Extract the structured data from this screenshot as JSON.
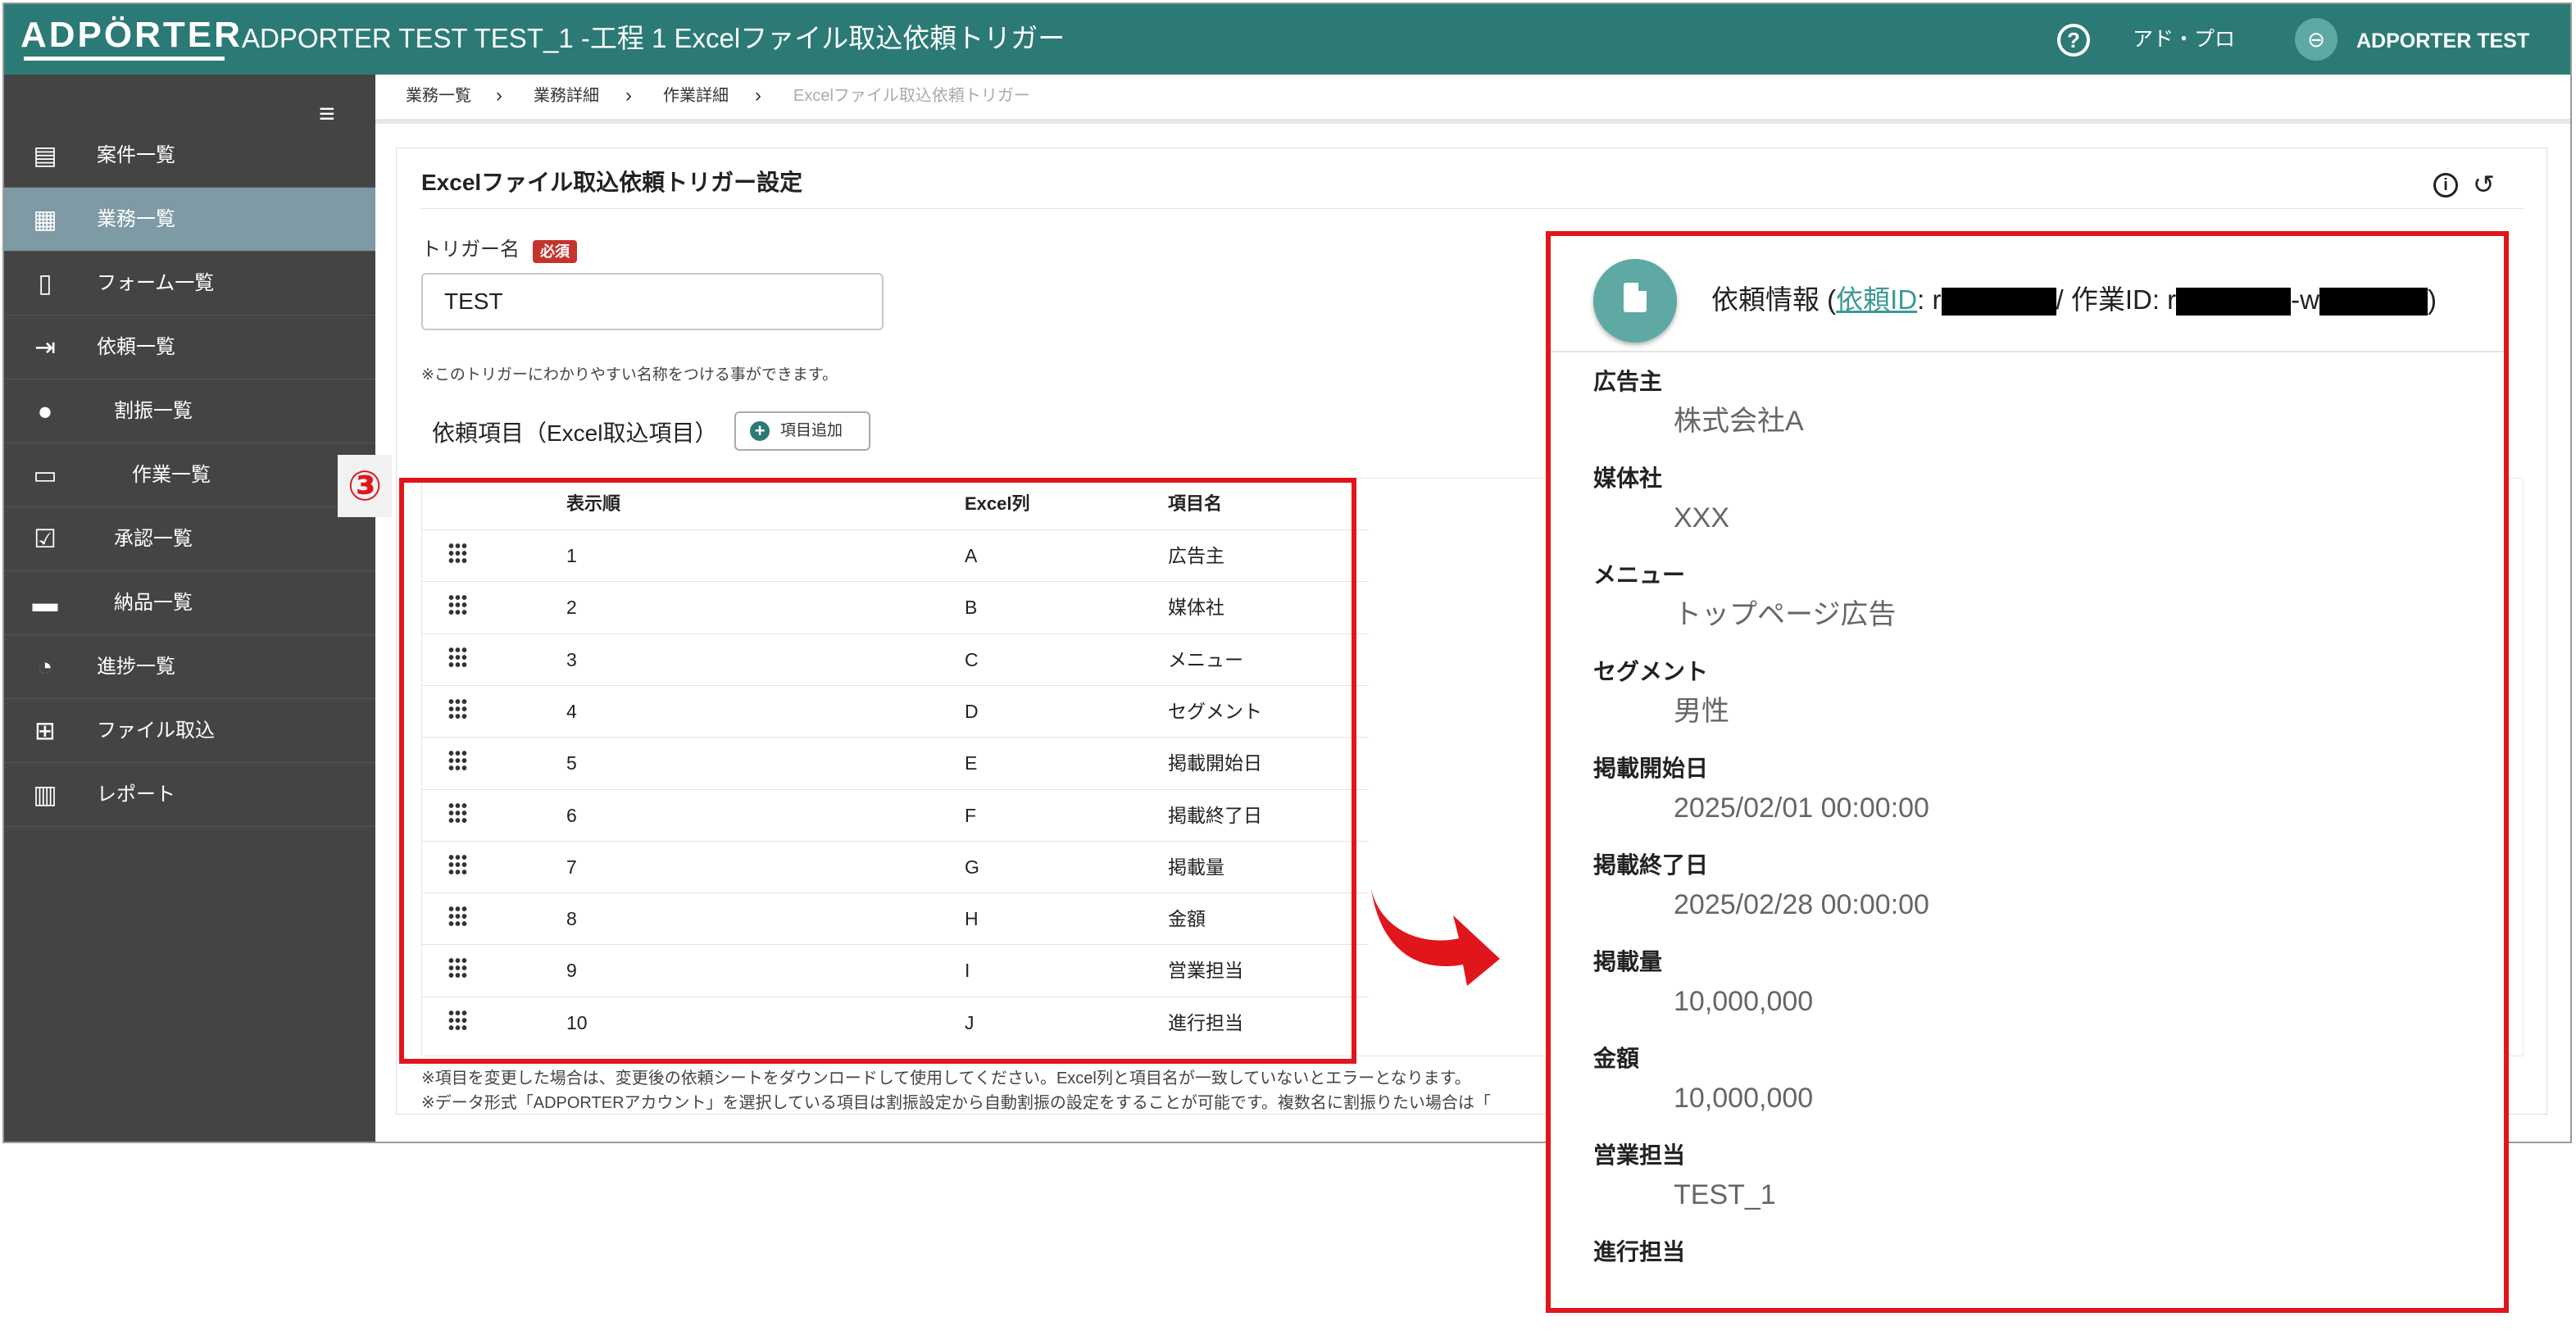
{
  "header": {
    "logo": "ADPÖRTER",
    "title": "ADPORTER TEST TEST_1 -工程 1 Excelファイル取込依頼トリガー",
    "help_icon": "help-circle-icon",
    "user_link": "アド・プロ",
    "avatar_icon": "robot-icon",
    "username": "ADPORTER TEST"
  },
  "sidebar": {
    "menu_icon": "hamburger-icon",
    "items": [
      {
        "label": "案件一覧",
        "icon": "document-icon",
        "glyph": "▤"
      },
      {
        "label": "業務一覧",
        "icon": "building-icon",
        "glyph": "▦"
      },
      {
        "label": "フォーム一覧",
        "icon": "form-icon",
        "glyph": "▯"
      },
      {
        "label": "依頼一覧",
        "icon": "inbox-icon",
        "glyph": "⇥"
      },
      {
        "label": "割振一覧",
        "icon": "people-icon",
        "glyph": "●"
      },
      {
        "label": "作業一覧",
        "icon": "monitor-icon",
        "glyph": "▭"
      },
      {
        "label": "承認一覧",
        "icon": "approval-icon",
        "glyph": "☑"
      },
      {
        "label": "納品一覧",
        "icon": "truck-icon",
        "glyph": "▬"
      },
      {
        "label": "進捗一覧",
        "icon": "clock-icon",
        "glyph": "◔"
      },
      {
        "label": "ファイル取込",
        "icon": "table-add-icon",
        "glyph": "⊞"
      },
      {
        "label": "レポート",
        "icon": "bar-chart-icon",
        "glyph": "▥"
      }
    ]
  },
  "breadcrumb": [
    "業務一覧",
    "業務詳細",
    "作業詳細",
    "Excelファイル取込依頼トリガー"
  ],
  "card": {
    "title": "Excelファイル取込依頼トリガー設定",
    "info_icon": "info-icon",
    "history_icon": "history-icon",
    "trigger_label": "トリガー名",
    "required_badge": "必須",
    "trigger_value": "TEST",
    "trigger_note": "※このトリガーにわかりやすい名称をつける事ができます。",
    "items_title": "依頼項目（Excel取込項目）",
    "add_button": "項目追加",
    "table": {
      "headers": [
        "表示順",
        "Excel列",
        "項目名"
      ],
      "rows": [
        [
          "1",
          "A",
          "広告主"
        ],
        [
          "2",
          "B",
          "媒体社"
        ],
        [
          "3",
          "C",
          "メニュー"
        ],
        [
          "4",
          "D",
          "セグメント"
        ],
        [
          "5",
          "E",
          "掲載開始日"
        ],
        [
          "6",
          "F",
          "掲載終了日"
        ],
        [
          "7",
          "G",
          "掲載量"
        ],
        [
          "8",
          "H",
          "金額"
        ],
        [
          "9",
          "I",
          "営業担当"
        ],
        [
          "10",
          "J",
          "進行担当"
        ]
      ]
    },
    "note1": "※項目を変更した場合は、変更後の依頼シートをダウンロードして使用してください。Excel列と項目名が一致していないとエラーとなります。",
    "note2": "※データ形式「ADPORTERアカウント」を選択している項目は割振設定から自動割振の設定をすることが可能です。複数名に割振りたい場合は「"
  },
  "annotation": {
    "step": "③"
  },
  "panel": {
    "title_prefix": "依頼情報 (",
    "title_link": "依頼ID",
    "title_colon": ": r",
    "title_mid": "/ 作業ID: r",
    "title_w": "-w",
    "title_suffix": ")",
    "fields": [
      {
        "label": "広告主",
        "value": "株式会社A"
      },
      {
        "label": "媒体社",
        "value": "XXX"
      },
      {
        "label": "メニュー",
        "value": "トップページ広告"
      },
      {
        "label": "セグメント",
        "value": "男性"
      },
      {
        "label": "掲載開始日",
        "value": "2025/02/01 00:00:00"
      },
      {
        "label": "掲載終了日",
        "value": "2025/02/28 00:00:00"
      },
      {
        "label": "掲載量",
        "value": "10,000,000"
      },
      {
        "label": "金額",
        "value": "10,000,000"
      },
      {
        "label": "営業担当",
        "value": "TEST_1"
      },
      {
        "label": "進行担当",
        "value": ""
      }
    ]
  }
}
